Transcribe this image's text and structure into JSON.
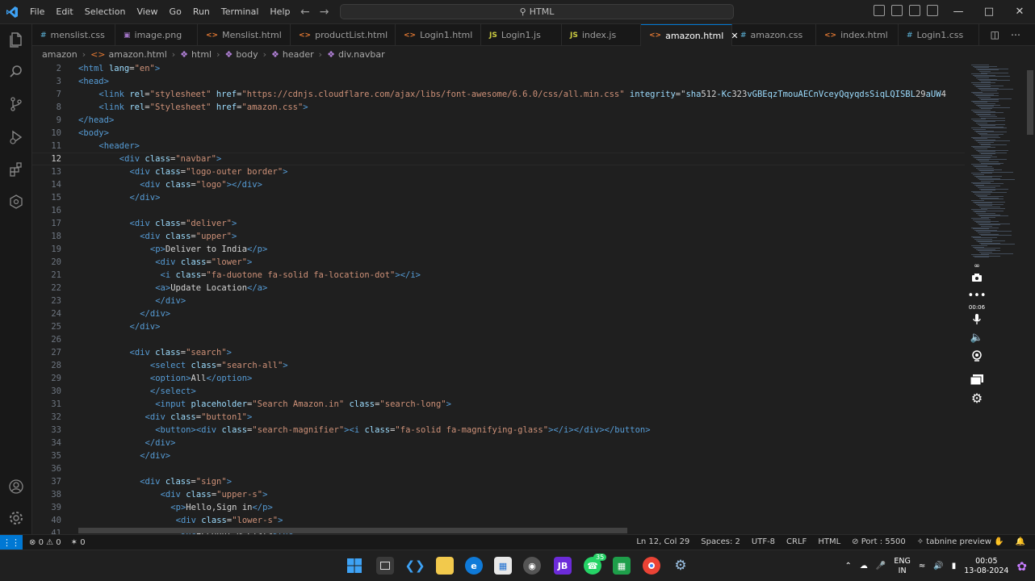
{
  "window": {
    "app_icon": "vscode-logo-icon",
    "menu": [
      "File",
      "Edit",
      "Selection",
      "View",
      "Go",
      "Run",
      "Terminal",
      "Help"
    ],
    "search_text": "HTML",
    "controls": [
      "minimize",
      "maximize",
      "close"
    ]
  },
  "tabs": [
    {
      "label": "menslist.css",
      "type": "css"
    },
    {
      "label": "image.png",
      "type": "img"
    },
    {
      "label": "Menslist.html",
      "type": "html"
    },
    {
      "label": "productList.html",
      "type": "html"
    },
    {
      "label": "Login1.html",
      "type": "html"
    },
    {
      "label": "Login1.js",
      "type": "js"
    },
    {
      "label": "index.js",
      "type": "js"
    },
    {
      "label": "amazon.html",
      "type": "html",
      "active": true
    },
    {
      "label": "amazon.css",
      "type": "css"
    },
    {
      "label": "index.html",
      "type": "html"
    },
    {
      "label": "Login1.css",
      "type": "css"
    }
  ],
  "breadcrumb": [
    "amazon",
    "amazon.html",
    "html",
    "body",
    "header",
    "div.navbar"
  ],
  "editor": {
    "cursor_line": 12,
    "lines": [
      {
        "n": "2",
        "indent": 0,
        "code": "<html lang=\"en\">"
      },
      {
        "n": "3",
        "indent": 0,
        "code": "<head>"
      },
      {
        "n": "7",
        "indent": 2,
        "code": "<link rel=\"stylesheet\" href=\"https://cdnjs.cloudflare.com/ajax/libs/font-awesome/6.6.0/css/all.min.css\" integrity=\"sha512-Kc323vGBEqzTmouAECnVceyQqyqdsSiqLQISBL29aUW4"
      },
      {
        "n": "8",
        "indent": 2,
        "code": "<link rel=\"Stylesheet\" href=\"amazon.css\">"
      },
      {
        "n": "9",
        "indent": 0,
        "code": "</head>"
      },
      {
        "n": "10",
        "indent": 0,
        "code": "<body>"
      },
      {
        "n": "11",
        "indent": 2,
        "code": "<header>"
      },
      {
        "n": "12",
        "indent": 4,
        "code": "<div class=\"navbar\">"
      },
      {
        "n": "13",
        "indent": 5,
        "code": "<div class=\"logo-outer border\">"
      },
      {
        "n": "14",
        "indent": 6,
        "code": "<div class=\"logo\"></div>"
      },
      {
        "n": "15",
        "indent": 5,
        "code": "</div>"
      },
      {
        "n": "16",
        "indent": 0,
        "code": ""
      },
      {
        "n": "17",
        "indent": 5,
        "code": "<div class=\"deliver\">"
      },
      {
        "n": "18",
        "indent": 6,
        "code": "<div class=\"upper\">"
      },
      {
        "n": "19",
        "indent": 7,
        "code": "<p>Deliver to India</p>"
      },
      {
        "n": "20",
        "indent": 7,
        "code": " <div class=\"lower\">"
      },
      {
        "n": "21",
        "indent": 7,
        "code": "  <i class=\"fa-duotone fa-solid fa-location-dot\"></i>"
      },
      {
        "n": "22",
        "indent": 7,
        "code": " <a>Update Location</a>"
      },
      {
        "n": "23",
        "indent": 7,
        "code": " </div>"
      },
      {
        "n": "24",
        "indent": 6,
        "code": "</div>"
      },
      {
        "n": "25",
        "indent": 5,
        "code": "</div>"
      },
      {
        "n": "26",
        "indent": 0,
        "code": ""
      },
      {
        "n": "27",
        "indent": 5,
        "code": "<div class=\"search\">"
      },
      {
        "n": "28",
        "indent": 7,
        "code": "<select class=\"search-all\">"
      },
      {
        "n": "29",
        "indent": 7,
        "code": "<option>All</option>"
      },
      {
        "n": "30",
        "indent": 7,
        "code": "</select>"
      },
      {
        "n": "31",
        "indent": 7,
        "code": " <input placeholder=\"Search Amazon.in\" class=\"search-long\">"
      },
      {
        "n": "32",
        "indent": 6,
        "code": " <div class=\"button1\">"
      },
      {
        "n": "33",
        "indent": 7,
        "code": " <button><div class=\"search-magnifier\"><i class=\"fa-solid fa-magnifying-glass\"></i></div></button>"
      },
      {
        "n": "34",
        "indent": 6,
        "code": " </div>"
      },
      {
        "n": "35",
        "indent": 6,
        "code": "</div>"
      },
      {
        "n": "36",
        "indent": 0,
        "code": ""
      },
      {
        "n": "37",
        "indent": 6,
        "code": "<div class=\"sign\">"
      },
      {
        "n": "38",
        "indent": 8,
        "code": "<div class=\"upper-s\">"
      },
      {
        "n": "39",
        "indent": 9,
        "code": "<p>Hello,Sign in</p>"
      },
      {
        "n": "40",
        "indent": 9,
        "code": " <div class=\"lower-s\">"
      },
      {
        "n": "41",
        "indent": 9,
        "code": "  <a>Account & Lists</a>"
      }
    ]
  },
  "status": {
    "errors": "0",
    "warnings": "0",
    "ports": "0",
    "position": "Ln 12, Col 29",
    "spaces": "Spaces: 2",
    "encoding": "UTF-8",
    "eol": "CRLF",
    "language": "HTML",
    "port": "Port : 5500",
    "tabnine": "tabnine preview"
  },
  "taskbar": {
    "lang_top": "ENG",
    "lang_bottom": "IN",
    "time": "00:05",
    "date": "13-08-2024",
    "whatsapp_badge": "35"
  },
  "recorder": {
    "time": "00:06"
  },
  "colors": {
    "accent": "#0078d4",
    "tag": "#569cd6",
    "attr": "#9cdcfe",
    "string": "#ce9178"
  }
}
